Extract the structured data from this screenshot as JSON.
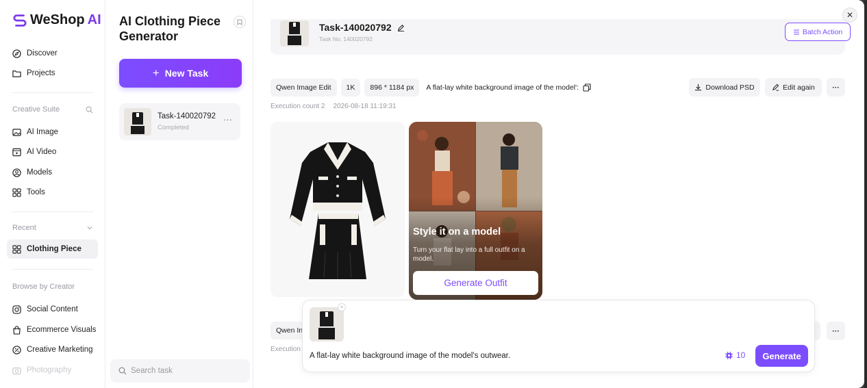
{
  "brand": {
    "name_main": "WeShop",
    "name_ai": "AI"
  },
  "nav": {
    "discover": "Discover",
    "projects": "Projects",
    "creative_suite": "Creative Suite",
    "ai_image": "AI Image",
    "ai_video": "AI Video",
    "models": "Models",
    "tools": "Tools",
    "recent": "Recent",
    "clothing_piece": "Clothing Piece",
    "browse_by_creator": "Browse by Creator",
    "social_content": "Social Content",
    "ecommerce_visuals": "Ecommerce Visuals",
    "creative_marketing": "Creative Marketing",
    "photography": "Photography"
  },
  "panel": {
    "title": "AI Clothing Piece Generator",
    "new_task": "New Task",
    "task_name": "Task-140020792",
    "task_status": "Completed",
    "more": "···",
    "search_placeholder": "Search task"
  },
  "header": {
    "task_title": "Task-140020792",
    "task_no": "Task No. 140020792",
    "batch_action": "Batch Action"
  },
  "result": {
    "model_tag": "Qwen Image Edit",
    "resolution_tag": "1K",
    "size_tag": "896 * 1184 px",
    "prompt_preview": "A flat-lay white background image of the model':",
    "download_psd": "Download PSD",
    "edit_again": "Edit again",
    "more": "···",
    "execution_count": "Execution count 2",
    "timestamp": "2026-08-18 11:19:31"
  },
  "second_row": {
    "model_tag_partial": "Qwen In",
    "execution_partial": "Execution",
    "more": "···"
  },
  "promo": {
    "title": "Style it on a model",
    "description": "Turn your flat lay into a full outfit on a model.",
    "button": "Generate Outfit"
  },
  "composer": {
    "prompt": "A flat-lay white background image of the model's outwear.",
    "credits": "10",
    "generate": "Generate"
  },
  "colors": {
    "accent": "#7c4dff",
    "muted": "#9a9aa3"
  }
}
